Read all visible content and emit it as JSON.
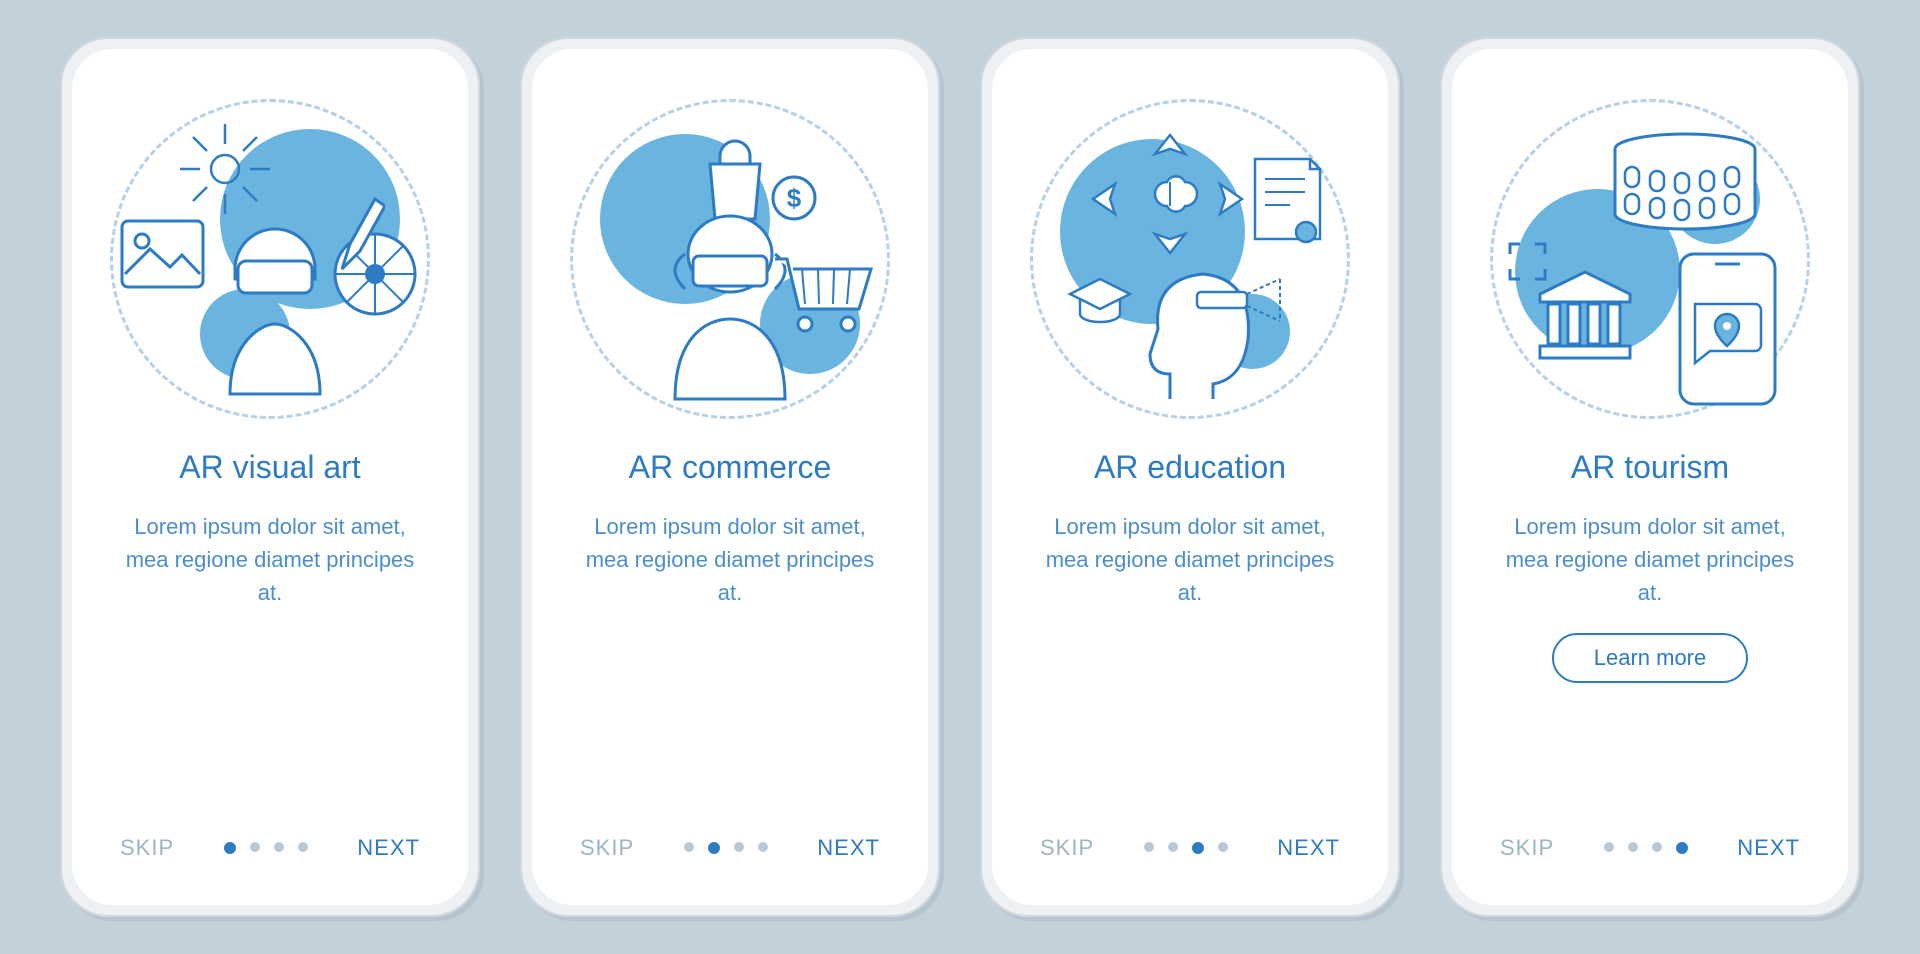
{
  "screens": [
    {
      "title": "AR visual art",
      "description": "Lorem ipsum dolor sit amet, mea regione diamet principes at.",
      "skip": "SKIP",
      "next": "NEXT",
      "activeDot": 0,
      "totalDots": 4,
      "illustration": "visual-art",
      "hasLearnMore": false
    },
    {
      "title": "AR commerce",
      "description": "Lorem ipsum dolor sit amet, mea regione diamet principes at.",
      "skip": "SKIP",
      "next": "NEXT",
      "activeDot": 1,
      "totalDots": 4,
      "illustration": "commerce",
      "hasLearnMore": false
    },
    {
      "title": "AR education",
      "description": "Lorem ipsum dolor sit amet, mea regione diamet principes at.",
      "skip": "SKIP",
      "next": "NEXT",
      "activeDot": 2,
      "totalDots": 4,
      "illustration": "education",
      "hasLearnMore": false
    },
    {
      "title": "AR tourism",
      "description": "Lorem ipsum dolor sit amet, mea regione diamet principes at.",
      "skip": "SKIP",
      "next": "NEXT",
      "activeDot": 3,
      "totalDots": 4,
      "illustration": "tourism",
      "hasLearnMore": true,
      "learnMore": "Learn more"
    }
  ],
  "colors": {
    "primary": "#2d7bc4",
    "accent": "#6ab5e0",
    "muted": "#9eb4c2",
    "background": "#c2d1da"
  }
}
